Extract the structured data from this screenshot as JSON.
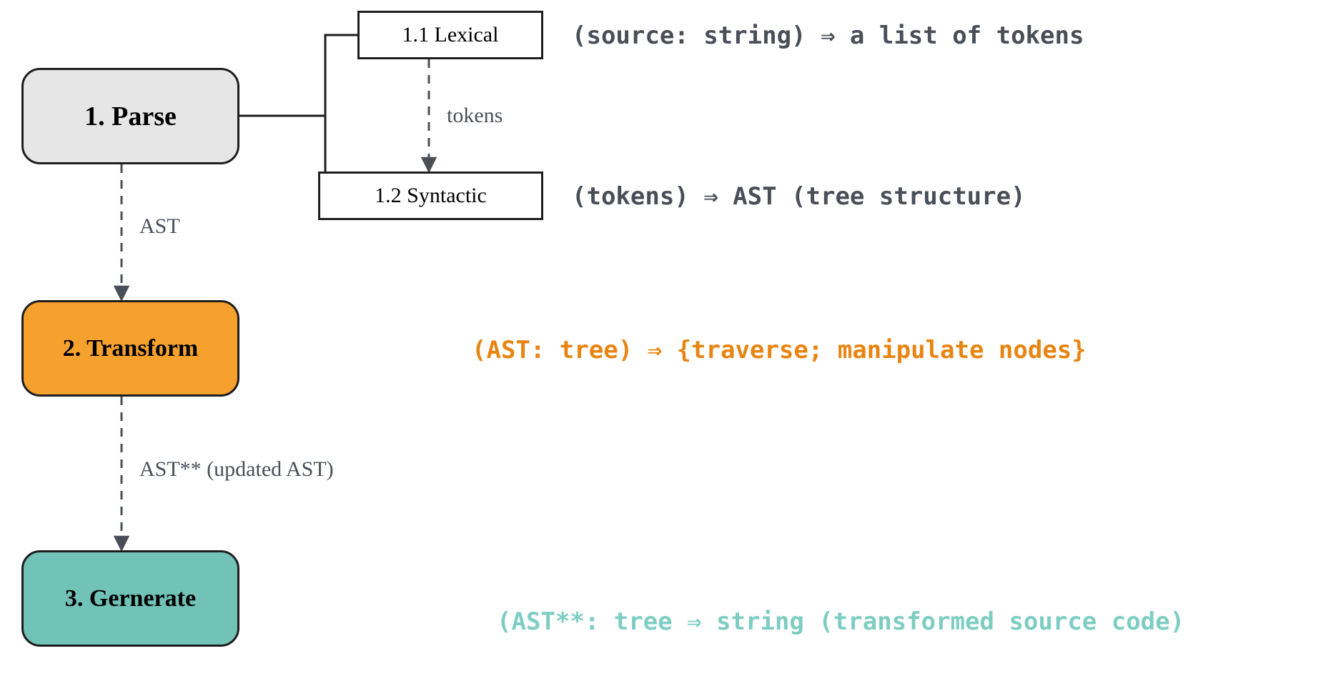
{
  "nodes": {
    "parse": "1. Parse",
    "transform": "2. Transform",
    "generate": "3. Gernerate",
    "lexical": "1.1 Lexical",
    "syntactic": "1.2 Syntactic"
  },
  "signatures": {
    "lexical": "(source: string) ⇒ a list of tokens",
    "syntactic": "(tokens) ⇒ AST (tree structure)",
    "transform": "(AST: tree) ⇒ {traverse; manipulate nodes}",
    "generate": "(AST**: tree ⇒ string (transformed source code)"
  },
  "edges": {
    "tokens": "tokens",
    "ast": "AST",
    "ast2": "AST** (updated AST)"
  },
  "colors": {
    "parse_bg": "#e6e6e6",
    "transform_bg": "#f6a12e",
    "generate_bg": "#71c2b7",
    "stroke": "#1e1e1e",
    "text_dark": "#4a4e57",
    "text_orange": "#e88512",
    "text_teal": "#7ecdc2"
  }
}
